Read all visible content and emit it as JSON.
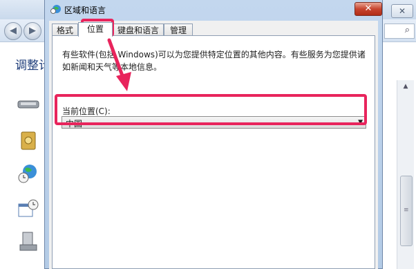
{
  "background_window": {
    "heading": "调整计",
    "close_label": "✕",
    "nav_back_glyph": "◀",
    "nav_forward_glyph": "▶",
    "search_icon": "search-icon",
    "icons": [
      "keyboard-icon",
      "safe-icon",
      "globe-clock-icon",
      "calendar-clock-icon",
      "computer-icon"
    ]
  },
  "dialog": {
    "title": "区域和语言",
    "close_label": "✕",
    "tabs": [
      {
        "label": "格式"
      },
      {
        "label": "位置",
        "active": true
      },
      {
        "label": "键盘和语言"
      },
      {
        "label": "管理"
      }
    ],
    "description": "有些软件(包括 Windows)可以为您提供特定位置的其他内容。有些服务为您提供诸如新闻和天气等本地信息。",
    "location_label": "当前位置(C):",
    "location_value": "中国",
    "dropdown_arrow": "▼"
  },
  "colors": {
    "annotation": "#e8245c",
    "dialog_frame": "#b3cbe6",
    "close_button": "#c7442f"
  }
}
